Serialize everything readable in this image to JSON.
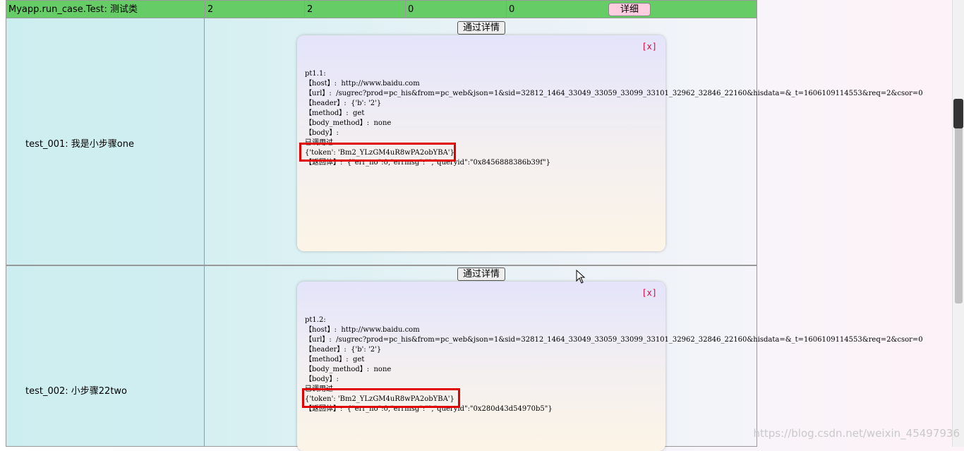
{
  "summary": {
    "class_name": "Myapp.run_case.Test: 测试类",
    "count": "2",
    "pass": "2",
    "fail": "0",
    "error": "0",
    "detail_label": "详细"
  },
  "cases": [
    {
      "name": "test_001: 我是小步骤one",
      "button_label": "通过详情",
      "close_label": "[x]",
      "log": "pt1.1:\n【host】:  http://www.baidu.com\n【url】:  /sugrec?prod=pc_his&from=pc_web&json=1&sid=32812_1464_33049_33059_33099_33101_32962_32846_22160&hisdata=&_t=1606109114553&req=2&csor=0\n【header】:  {'b': '2'}\n【method】:  get\n【body_method】:  none\n【body】:\n已调用过\n{'token': 'Bm2_YLzGM4uR8wPA2obYBA'}\n【返回体】:  {\"err_no\":0,\"errmsg\":\"\",\"queryid\":\"0x8456888386b39f\"}"
    },
    {
      "name": "test_002: 小步骤22two",
      "button_label": "通过详情",
      "close_label": "[x]",
      "log": "pt1.2:\n【host】:  http://www.baidu.com\n【url】:  /sugrec?prod=pc_his&from=pc_web&json=1&sid=32812_1464_33049_33059_33099_33101_32962_32846_22160&hisdata=&_t=1606109114553&req=2&csor=0\n【header】:  {'b': '2'}\n【method】:  get\n【body_method】:  none\n【body】:\n已调用过\n{'token': 'Bm2_YLzGM4uR8wPA2obYBA'}\n【返回体】:  {\"err_no\":0,\"errmsg\":\"\",\"queryid\":\"0x280d43d54970b5\"}"
    }
  ],
  "watermark": "https://blog.csdn.net/weixin_45497936",
  "colors": {
    "summary_bg": "#66cc66",
    "highlight": "#e00000",
    "close": "#e8003c",
    "detail_btn": "#ffcce0"
  },
  "icons": [
    "mouse-cursor-icon"
  ]
}
